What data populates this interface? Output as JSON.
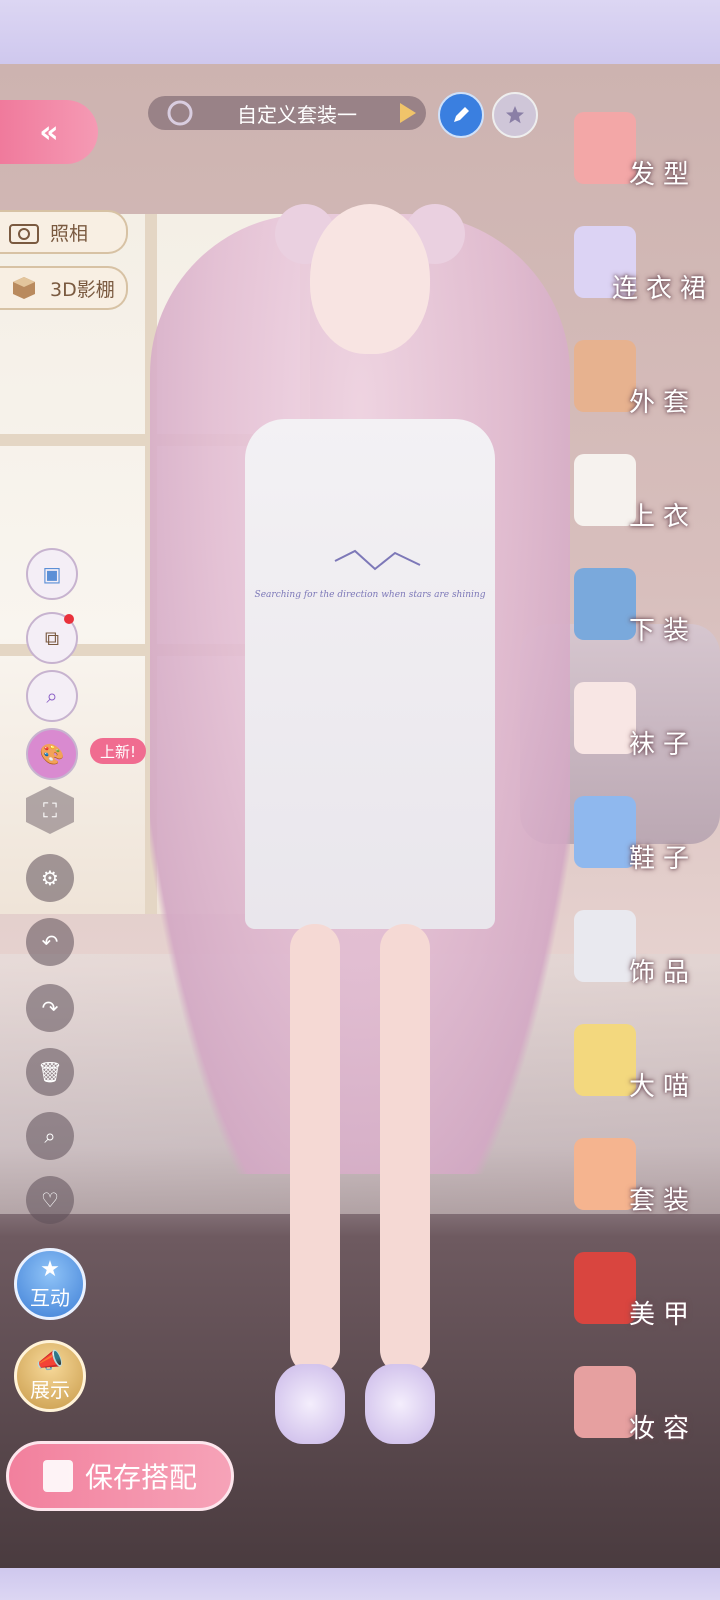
{
  "header": {
    "back_icon": "double-chevron-left-icon",
    "outfit_name": "自定义套装一",
    "edit_icon": "pencil-icon",
    "favorite_icon": "star-icon"
  },
  "left_buttons": {
    "photo_label": "照相",
    "studio_label": "3D影棚"
  },
  "tools": {
    "new_badge": "上新!",
    "interact_label": "互动",
    "display_label": "展示"
  },
  "save": {
    "label": "保存搭配"
  },
  "categories": [
    {
      "label": "发型",
      "icon": "hair-icon",
      "color": "#f3a7a7"
    },
    {
      "label": "连衣裙",
      "icon": "dress-icon",
      "color": "#dcd3f4"
    },
    {
      "label": "外套",
      "icon": "jacket-icon",
      "color": "#e7b28f"
    },
    {
      "label": "上衣",
      "icon": "top-icon",
      "color": "#f6f2ee"
    },
    {
      "label": "下装",
      "icon": "shorts-icon",
      "color": "#7aa9dc"
    },
    {
      "label": "袜子",
      "icon": "sock-icon",
      "color": "#f8e6e4"
    },
    {
      "label": "鞋子",
      "icon": "shoe-icon",
      "color": "#8fb8ee"
    },
    {
      "label": "饰品",
      "icon": "tiara-icon",
      "color": "#e9e9ef"
    },
    {
      "label": "大喵",
      "icon": "cat-icon",
      "color": "#f3d87e"
    },
    {
      "label": "套装",
      "icon": "suit-icon",
      "color": "#f5b48f"
    },
    {
      "label": "美甲",
      "icon": "nail-polish-icon",
      "color": "#d9453f"
    },
    {
      "label": "妆容",
      "icon": "makeup-icon",
      "color": "#e6a0a0"
    }
  ],
  "shirt_text": "Searching for the direction when stars are shining"
}
